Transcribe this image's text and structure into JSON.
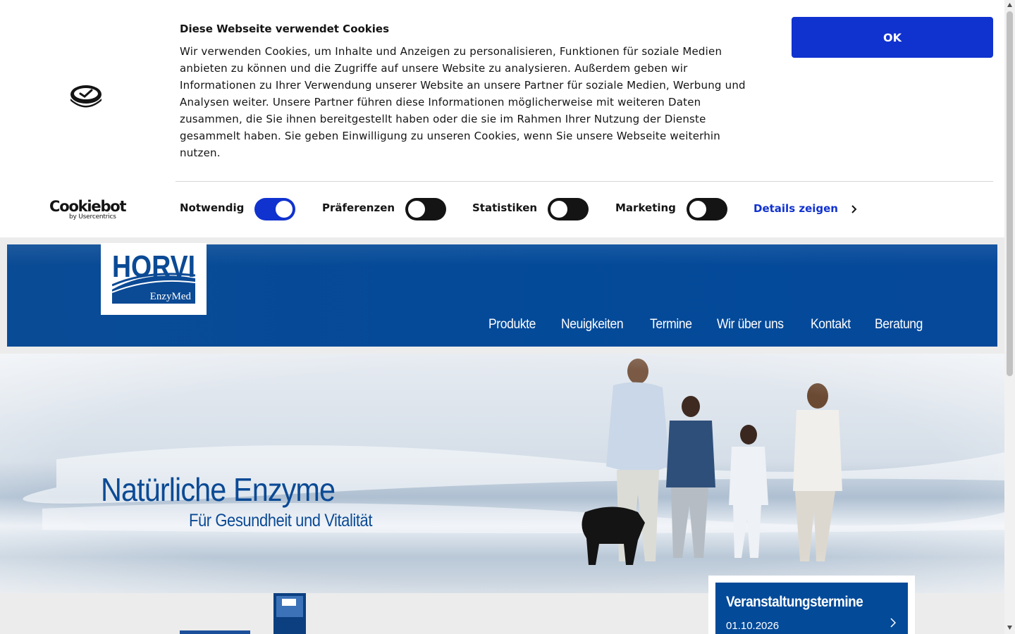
{
  "cookie_banner": {
    "title": "Diese Webseite verwendet Cookies",
    "text": "Wir verwenden Cookies, um Inhalte und Anzeigen zu personalisieren, Funktionen für soziale Medien anbieten zu können und die Zugriffe auf unsere Website zu analysieren. Außerdem geben wir Informationen zu Ihrer Verwendung unserer Website an unsere Partner für soziale Medien, Werbung und Analysen weiter. Unsere Partner führen diese Informationen möglicherweise mit weiteren Daten zusammen, die Sie ihnen bereitgestellt haben oder die sie im Rahmen Ihrer Nutzung der Dienste gesammelt haben. Sie geben Einwilligung zu unseren Cookies, wenn Sie unsere Webseite weiterhin nutzen.",
    "ok_label": "OK",
    "brand_main": "Cookiebot",
    "brand_sub": "by Usercentrics",
    "toggles": [
      {
        "label": "Notwendig",
        "on": true
      },
      {
        "label": "Präferenzen",
        "on": false
      },
      {
        "label": "Statistiken",
        "on": false
      },
      {
        "label": "Marketing",
        "on": false
      }
    ],
    "details_label": "Details zeigen"
  },
  "header": {
    "logo_text": "HORVI",
    "logo_sub": "EnzyMed",
    "nav": [
      "Produkte",
      "Neuigkeiten",
      "Termine",
      "Wir über uns",
      "Kontakt",
      "Beratung"
    ]
  },
  "hero": {
    "title": "Natürliche Enzyme",
    "subtitle": "Für Gesundheit und Vitalität"
  },
  "events": {
    "title": "Veranstaltungstermine",
    "date": "01.10.2026"
  },
  "colors": {
    "brand_blue": "#034a99",
    "cookie_blue": "#1032cf"
  }
}
